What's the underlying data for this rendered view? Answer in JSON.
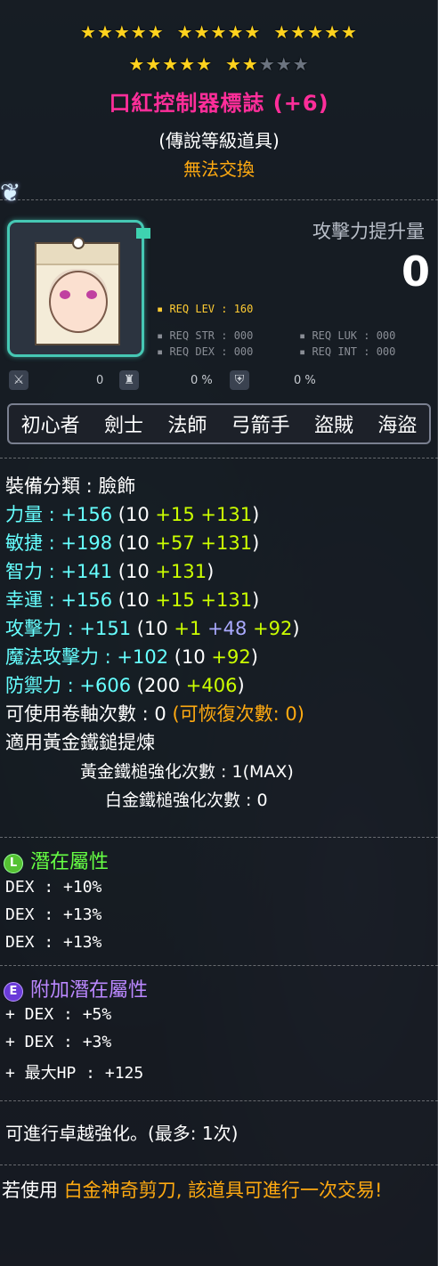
{
  "stars": {
    "row1": [
      5,
      5,
      5
    ],
    "row2_filled": 8,
    "row2_total": 10
  },
  "item": {
    "title": "口紅控制器標誌 (+6)",
    "grade": "(傳說等級道具)",
    "tradability": "無法交換"
  },
  "attack_gain": {
    "label": "攻擊力提升量",
    "value": "0"
  },
  "requirements": {
    "level": "REQ LEV : 160",
    "str": "REQ STR : 000",
    "luk": "REQ LUK : 000",
    "dex": "REQ DEX : 000",
    "int": "REQ INT : 000"
  },
  "mini_stats": {
    "first": "0",
    "second": "0 %",
    "third": "0 %"
  },
  "jobs": [
    "初心者",
    "劍士",
    "法師",
    "弓箭手",
    "盜賊",
    "海盜"
  ],
  "stats": {
    "category": "裝備分類 : 臉飾",
    "str": {
      "label": "力量 : +156",
      "base": "(10",
      "scroll": "+15",
      "flame": "+131",
      "close": ")"
    },
    "dex": {
      "label": "敏捷 : +198",
      "base": "(10",
      "scroll": "+57",
      "flame": "+131",
      "close": ")"
    },
    "int": {
      "label": "智力 : +141",
      "base": "(10",
      "flame": "+131",
      "close": ")"
    },
    "luk": {
      "label": "幸運 : +156",
      "base": "(10",
      "scroll": "+15",
      "flame": "+131",
      "close": ")"
    },
    "atk": {
      "label": "攻擊力 : +151",
      "base": "(10",
      "b1": "+1",
      "b2": "+48",
      "b3": "+92",
      "close": ")"
    },
    "matk": {
      "label": "魔法攻擊力 : +102",
      "base": "(10",
      "b1": "+92",
      "close": ")"
    },
    "def": {
      "label": "防禦力 : +606",
      "base": "(200",
      "b1": "+406",
      "close": ")"
    },
    "upgrades": "可使用卷軸次數 : 0",
    "restore": "(可恢復次數: 0)",
    "hammer_applied": "適用黃金鐵鎚提煉",
    "golden_hammer": "黃金鐵槌強化次數 : 1(MAX)",
    "platinum_hammer": "白金鐵槌強化次數 : 0"
  },
  "potential": {
    "title": "潛在屬性",
    "badge": "L",
    "lines": [
      "DEX : +10%",
      "DEX : +13%",
      "DEX : +13%"
    ]
  },
  "bonus_potential": {
    "title": "附加潛在屬性",
    "badge": "E",
    "lines": [
      "+ DEX : +5%",
      "+ DEX : +3%",
      "+ 最大HP : +125"
    ]
  },
  "star_force": "可進行卓越強化。(最多: 1次)",
  "scissors": {
    "prefix": "若使用 ",
    "item": "白金神奇剪刀",
    "suffix": ", 該道具可進行一次交易!"
  },
  "colors": {
    "title": "#ff2e9a",
    "stat_label": "#66ffff",
    "bonus": "#ccff00",
    "orange": "#ffaa11",
    "frame": "#46c8b4"
  }
}
